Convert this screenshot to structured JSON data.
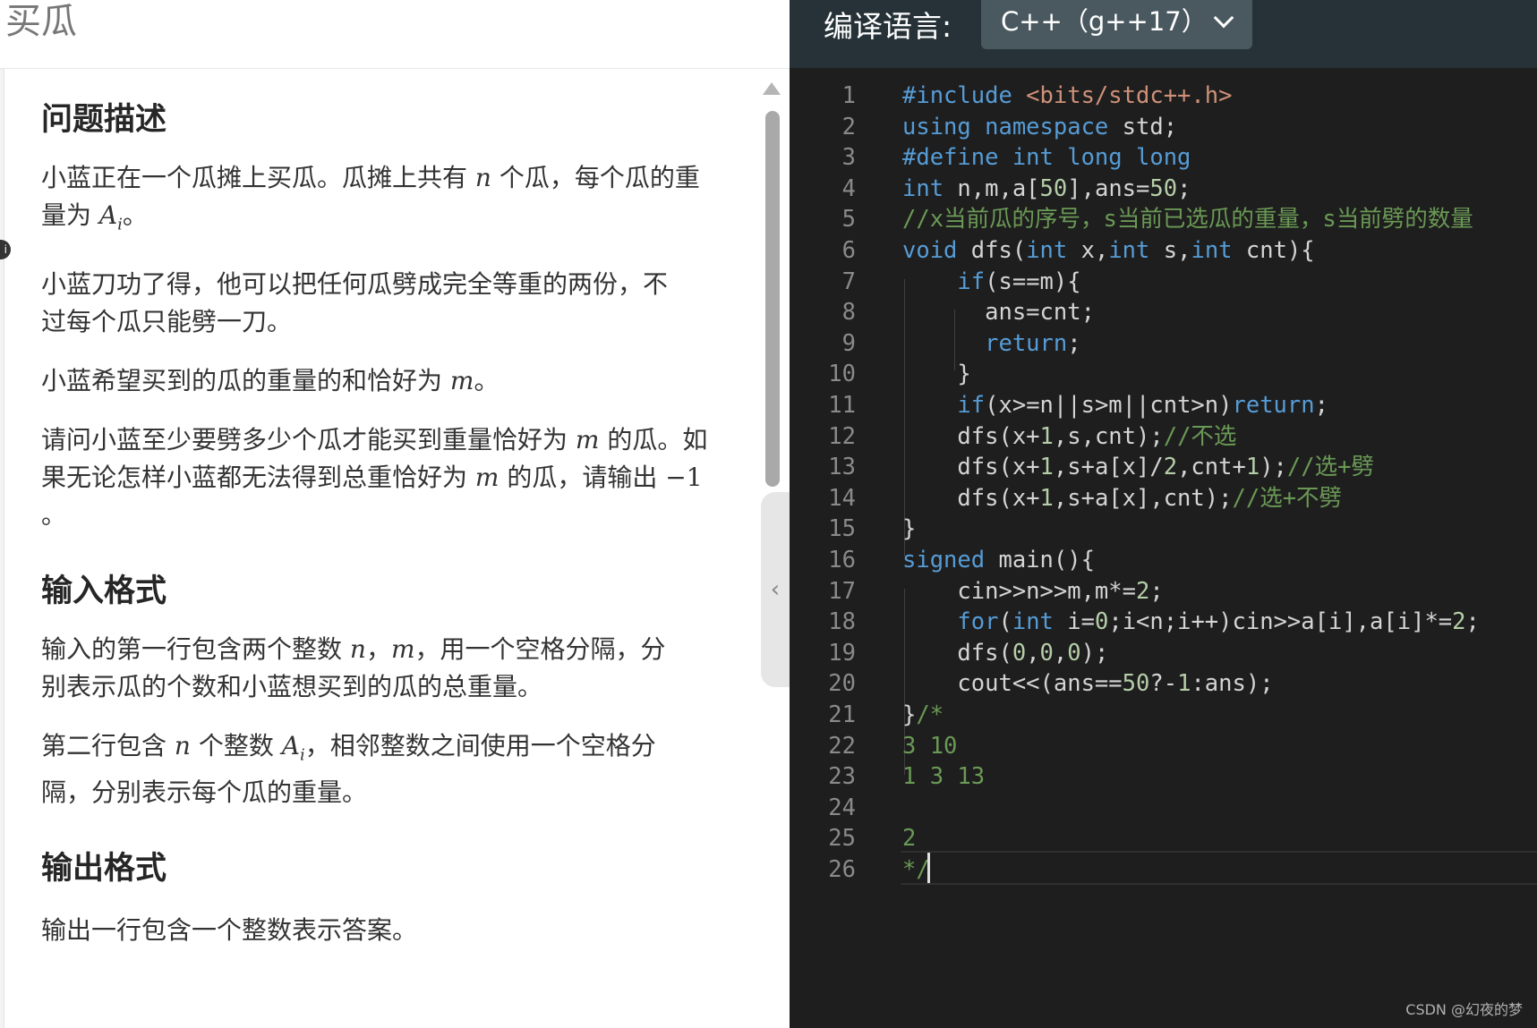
{
  "problem": {
    "title": "买瓜",
    "sections": {
      "desc_heading": "问题描述",
      "p1_a": "小蓝正在一个瓜摊上买瓜。瓜摊上共有 ",
      "p1_n": "n",
      "p1_b": " 个瓜，每个瓜的重",
      "p1_c": "量为 ",
      "p1_A": "A",
      "p1_i": "i",
      "p1_d": "。",
      "p2": "小蓝刀功了得，他可以把任何瓜劈成完全等重的两份，不过每个瓜只能劈一刀。",
      "p3_a": "小蓝希望买到的瓜的重量的和恰好为 ",
      "p3_m": "m",
      "p3_b": "。",
      "p4_a": "请问小蓝至少要劈多少个瓜才能买到重量恰好为 ",
      "p4_m": "m",
      "p4_b": " 的瓜。如",
      "p4_c": "果无论怎样小蓝都无法得到总重恰好为 ",
      "p4_m2": "m",
      "p4_d": " 的瓜，请输出 ",
      "p4_neg": "−1",
      "p4_e": "。",
      "input_heading": "输入格式",
      "in1_a": "输入的第一行包含两个整数 ",
      "in1_n": "n",
      "in1_sep": "，",
      "in1_m": "m",
      "in1_b": "，用一个空格分隔，分别表示瓜的个数和小蓝想买到的瓜的总重量。",
      "in2_a": "第二行包含 ",
      "in2_n": "n",
      "in2_b": " 个整数 ",
      "in2_A": "A",
      "in2_i": "i",
      "in2_c": "，相邻整数之间使用一个空格分隔，分别表示每个瓜的重量。",
      "output_heading": "输出格式",
      "out1": "输出一行包含一个整数表示答案。"
    },
    "edge_icon": "i"
  },
  "editor": {
    "lang_label": "编译语言:",
    "lang_value": "C++（g++17）",
    "line_numbers": [
      "1",
      "2",
      "3",
      "4",
      "5",
      "6",
      "7",
      "8",
      "9",
      "10",
      "11",
      "12",
      "13",
      "14",
      "15",
      "16",
      "17",
      "18",
      "19",
      "20",
      "21",
      "22",
      "23",
      "24",
      "25",
      "26"
    ],
    "cursor_line": 26
  },
  "watermark": "CSDN @幻夜的梦",
  "colors": {
    "editor_bg": "#1e1e1e",
    "topbar_bg": "#263238",
    "keyword": "#569cd6",
    "number": "#b5cea8",
    "string": "#ce9178",
    "comment": "#6a9955"
  }
}
